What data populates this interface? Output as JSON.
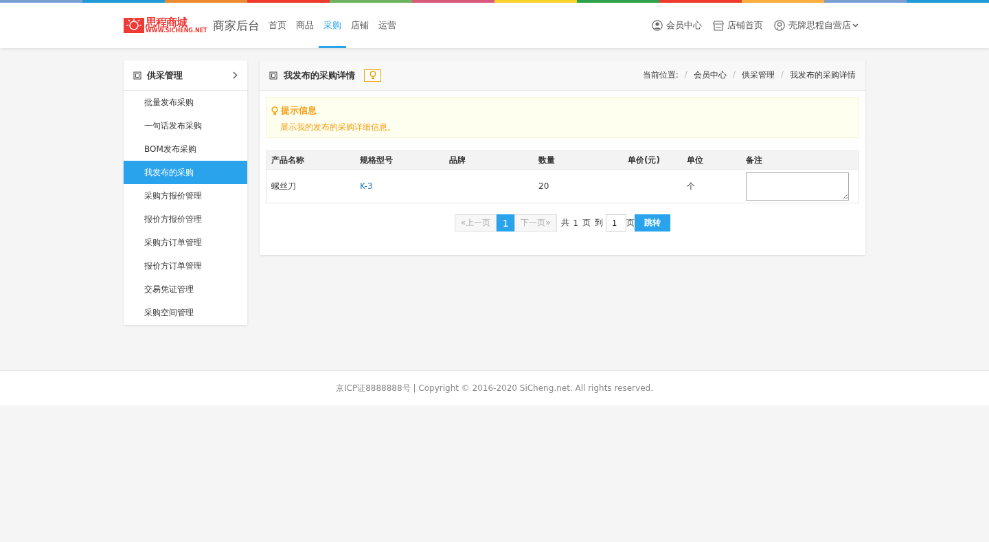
{
  "header": {
    "logo": {
      "name": "思程商城",
      "url": "WWW.SICHENG.NET"
    },
    "title": "商家后台",
    "nav": [
      {
        "label": "首页",
        "selected": false
      },
      {
        "label": "商品",
        "selected": false
      },
      {
        "label": "采购",
        "selected": true
      },
      {
        "label": "店铺",
        "selected": false
      },
      {
        "label": "运营",
        "selected": false
      }
    ],
    "links": [
      {
        "kind": "member",
        "label": "会员中心"
      },
      {
        "kind": "store",
        "label": "店铺首页"
      },
      {
        "kind": "account",
        "label": "壳牌思程自营店"
      }
    ]
  },
  "sidebar": {
    "title": "供采管理",
    "items": [
      {
        "label": "批量发布采购",
        "selected": false
      },
      {
        "label": "一句话发布采购",
        "selected": false
      },
      {
        "label": "BOM发布采购",
        "selected": false
      },
      {
        "label": "我发布的采购",
        "selected": true
      },
      {
        "label": "采购方报价管理",
        "selected": false
      },
      {
        "label": "报价方报价管理",
        "selected": false
      },
      {
        "label": "采购方订单管理",
        "selected": false
      },
      {
        "label": "报价方订单管理",
        "selected": false
      },
      {
        "label": "交易凭证管理",
        "selected": false
      },
      {
        "label": "采购空间管理",
        "selected": false
      }
    ]
  },
  "panel": {
    "title": "我发布的采购详情",
    "breadcrumb_label": "当前位置:",
    "breadcrumb_separator": "/",
    "breadcrumb": [
      "会员中心",
      "供采管理",
      "我发布的采购详情"
    ],
    "notice": {
      "title": "提示信息",
      "text": "展示我的发布的采购详细信息。"
    },
    "table": {
      "columns": [
        "产品名称",
        "规格型号",
        "品牌",
        "数量",
        "单价(元)",
        "单位",
        "备注"
      ],
      "rows": [
        {
          "name": "螺丝刀",
          "spec": "K-3",
          "quantity": "20",
          "unit": "个"
        }
      ]
    },
    "pagination": {
      "prev": {
        "label": "«上一页",
        "disabled": true
      },
      "pages": [
        {
          "label": "1",
          "selected": true
        }
      ],
      "next": {
        "label": "下一页»",
        "disabled": true
      },
      "total_prefix": "共",
      "total": "1",
      "total_suffix": "页",
      "goto_prefix": "到",
      "goto_value": "1",
      "goto_suffix": "页",
      "goto_button": "跳转"
    }
  },
  "footer": "京ICP证8888888号 | Copyright © 2016-2020 SiCheng.net. All rights reserved."
}
